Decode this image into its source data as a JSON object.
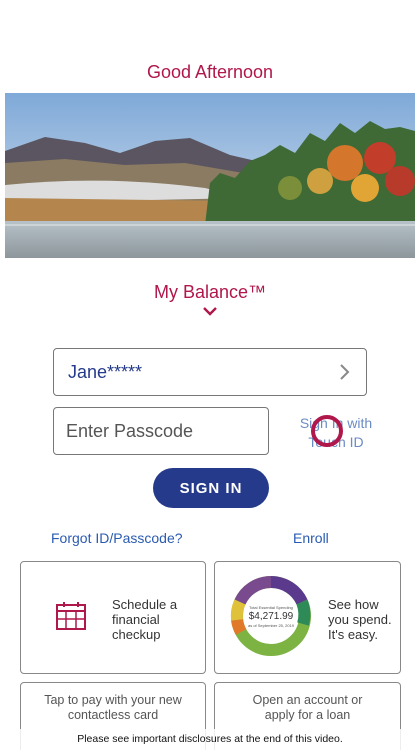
{
  "greeting": "Good Afternoon",
  "hero_alt": "mountain-lake-autumn-landscape",
  "balance": {
    "label": "My Balance™"
  },
  "login": {
    "username": "Jane*****",
    "passcode_placeholder": "Enter Passcode",
    "touch_id_label": "Sign In with Touch ID",
    "sign_in_button": "SIGN IN",
    "forgot_link": "Forgot ID/Passcode?",
    "enroll_link": "Enroll"
  },
  "cards": [
    {
      "label": "Schedule a financial checkup",
      "icon": "calendar-icon"
    },
    {
      "label": "See how you spend. It's easy.",
      "donut_amount": "$4,271.99",
      "donut_caption": "Total Essential Spending",
      "donut_sub": "as of September 25, 2019"
    },
    {
      "label": "Tap to pay with your new contactless card"
    },
    {
      "label": "Open an account or apply for a loan"
    }
  ],
  "disclosure": "Please see important disclosures at the end of this video.",
  "colors": {
    "brand_red": "#b0174a",
    "brand_navy": "#253a8a",
    "link_blue": "#2a5bb0"
  }
}
